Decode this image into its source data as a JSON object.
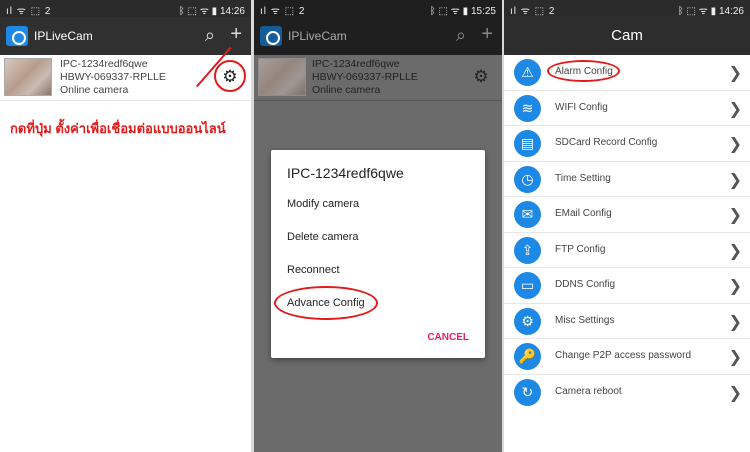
{
  "panel1": {
    "status_left": "ıl ᯤ ⬚ 2",
    "status_right": "ᛒ ⬚ ᯤ ▮ 14:26",
    "app_title": "IPLiveCam",
    "search_icon": "search-icon",
    "add_icon": "plus-icon",
    "camera": {
      "id": "IPC-1234redf6qwe",
      "serial": "HBWY-069337-RPLLE",
      "status": "Online camera"
    },
    "annotation": "กดที่ปุ่ม ตั้งค่าเพื่อเชื่อมต่อแบบออนไลน์"
  },
  "panel2": {
    "status_left": "ıl ᯤ ⬚ 2",
    "status_right": "ᛒ ⬚ ᯤ ▮ 15:25",
    "app_title": "IPLiveCam",
    "camera": {
      "id": "IPC-1234redf6qwe",
      "serial": "HBWY-069337-RPLLE",
      "status": "Online camera"
    },
    "dialog": {
      "title": "IPC-1234redf6qwe",
      "items": [
        "Modify camera",
        "Delete camera",
        "Reconnect",
        "Advance Config"
      ],
      "cancel": "CANCEL"
    }
  },
  "panel3": {
    "status_left": "ıl ᯤ ⬚ 2",
    "status_right": "ᛒ ⬚ ᯤ ▮ 14:26",
    "title": "Cam",
    "menu": [
      {
        "label": "Alarm Config",
        "icon": "⚠"
      },
      {
        "label": "WIFI Config",
        "icon": "≋"
      },
      {
        "label": "SDCard Record Config",
        "icon": "▤"
      },
      {
        "label": "Time Setting",
        "icon": "◷"
      },
      {
        "label": "EMail Config",
        "icon": "✉"
      },
      {
        "label": "FTP Config",
        "icon": "⇪"
      },
      {
        "label": "DDNS Config",
        "icon": "▭"
      },
      {
        "label": "Misc Settings",
        "icon": "⚙"
      },
      {
        "label": "Change P2P access password",
        "icon": "🔑"
      },
      {
        "label": "Camera reboot",
        "icon": "↻"
      }
    ]
  },
  "colors": {
    "accent": "#1e88e5",
    "highlight": "#e21b1b",
    "cancel": "#e91e63"
  }
}
